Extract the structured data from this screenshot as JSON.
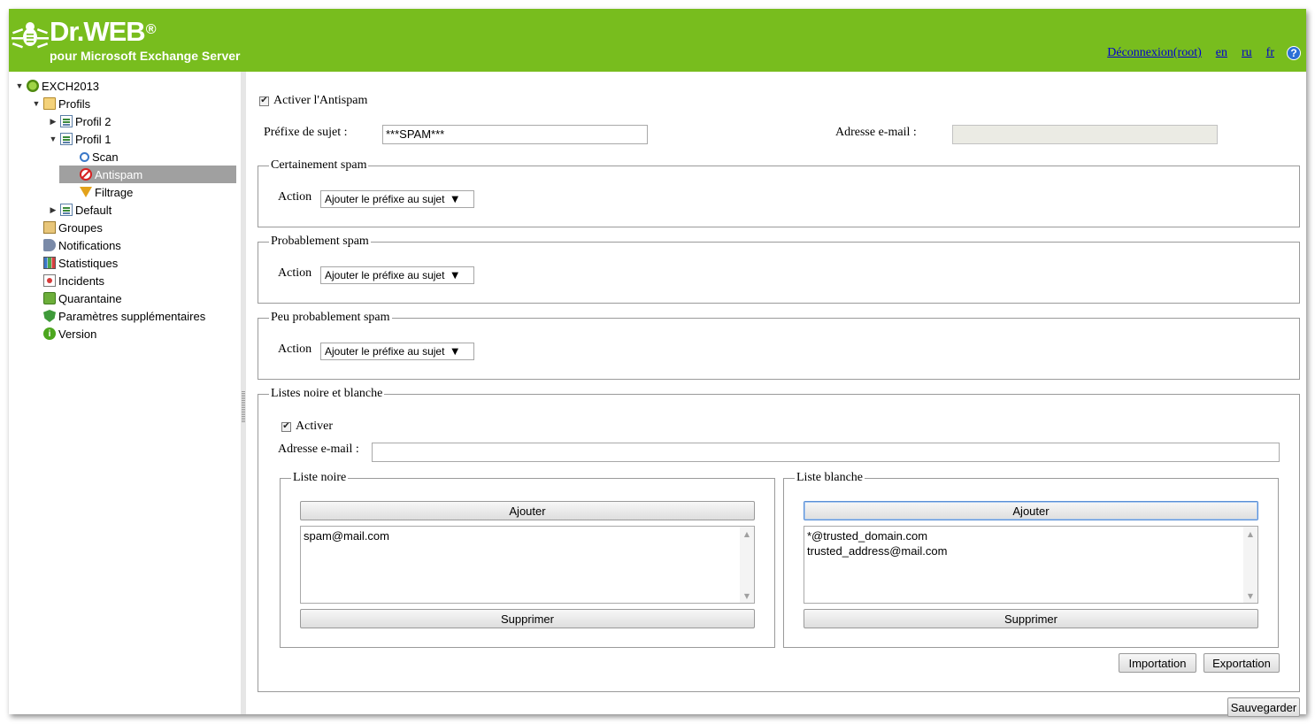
{
  "header": {
    "brand": "Dr.WEB",
    "brand_reg": "®",
    "subtitle": "pour Microsoft Exchange Server",
    "logout_label": "Déconnexion(root)",
    "languages": [
      "en",
      "ru",
      "fr"
    ],
    "help_glyph": "?",
    "background_color": "#78bd1e"
  },
  "tree": {
    "root": "EXCH2013",
    "profils": "Profils",
    "profil2": "Profil 2",
    "profil1": "Profil 1",
    "scan": "Scan",
    "antispam": "Antispam",
    "filtrage": "Filtrage",
    "default": "Default",
    "groupes": "Groupes",
    "notifications": "Notifications",
    "statistiques": "Statistiques",
    "incidents": "Incidents",
    "quarantaine": "Quarantaine",
    "parametres": "Paramètres supplémentaires",
    "version": "Version",
    "selected": "Antispam",
    "version_glyph": "i"
  },
  "form": {
    "enable_antispam_label": "Activer l'Antispam",
    "enable_antispam_checked": true,
    "subject_prefix_label": "Préfixe de sujet :",
    "subject_prefix_value": "***SPAM***",
    "email_label": "Adresse e-mail :",
    "email_value": ""
  },
  "sections": {
    "certain": {
      "legend": "Certainement spam",
      "action_label": "Action",
      "action_value": "Ajouter le préfixe au sujet"
    },
    "probable": {
      "legend": "Probablement spam",
      "action_label": "Action",
      "action_value": "Ajouter le préfixe au sujet"
    },
    "unlikely": {
      "legend": "Peu probablement spam",
      "action_label": "Action",
      "action_value": "Ajouter le préfixe au sujet"
    }
  },
  "lists": {
    "legend": "Listes noire et blanche",
    "enable_label": "Activer",
    "enable_checked": true,
    "email_label": "Adresse e-mail :",
    "email_value": "",
    "blacklist": {
      "legend": "Liste noire",
      "add_label": "Ajouter",
      "remove_label": "Supprimer",
      "items": [
        "spam@mail.com"
      ]
    },
    "whitelist": {
      "legend": "Liste blanche",
      "add_label": "Ajouter",
      "remove_label": "Supprimer",
      "items": [
        "*@trusted_domain.com",
        "trusted_address@mail.com"
      ]
    },
    "import_label": "Importation",
    "export_label": "Exportation"
  },
  "save_label": "Sauvegarder"
}
